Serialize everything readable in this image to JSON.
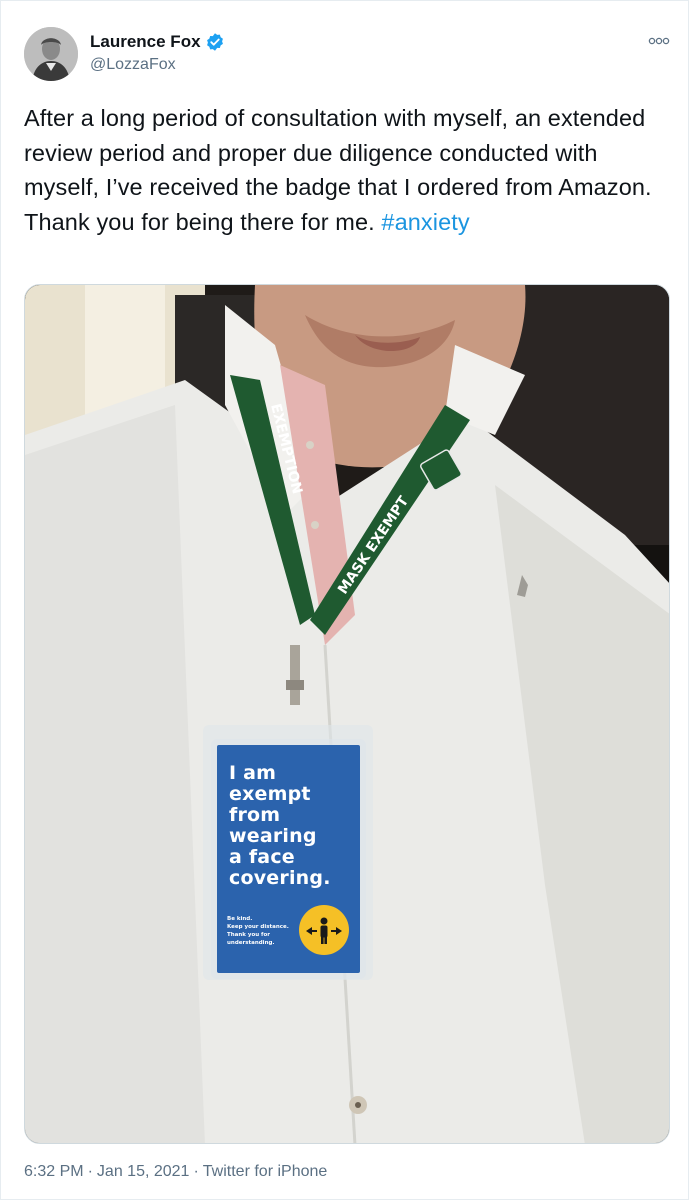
{
  "author": {
    "name": "Laurence Fox",
    "handle": "@LozzaFox",
    "verified": true,
    "avatar_icon": "user-photo-avatar"
  },
  "tweet": {
    "text_before_hashtag": "After a long period of consultation with myself, an extended review period and proper due diligence conducted with myself, I’ve received the badge that I ordered from Amazon. Thank you for being there for me. ",
    "hashtag": "#anxiety"
  },
  "media": {
    "lanyard_text_left": "EXEMPTION",
    "lanyard_text_right": "MASK EXEMPT",
    "badge": {
      "headline_lines": [
        "I am",
        "exempt",
        "from",
        "wearing",
        "a face",
        "covering."
      ],
      "footer_lines": [
        "Be kind.",
        "Keep your distance.",
        "Thank you for",
        "understanding."
      ],
      "icon": "social-distance-icon",
      "color": "#2b63ad",
      "icon_bg": "#f5c026"
    }
  },
  "meta": {
    "time": "6:32 PM",
    "separator1": "·",
    "date": "Jan 15, 2021",
    "separator2": "·",
    "source": "Twitter for iPhone"
  },
  "colors": {
    "accent": "#1b95e0",
    "secondary_text": "#5b7083",
    "verified": "#1da1f2"
  }
}
